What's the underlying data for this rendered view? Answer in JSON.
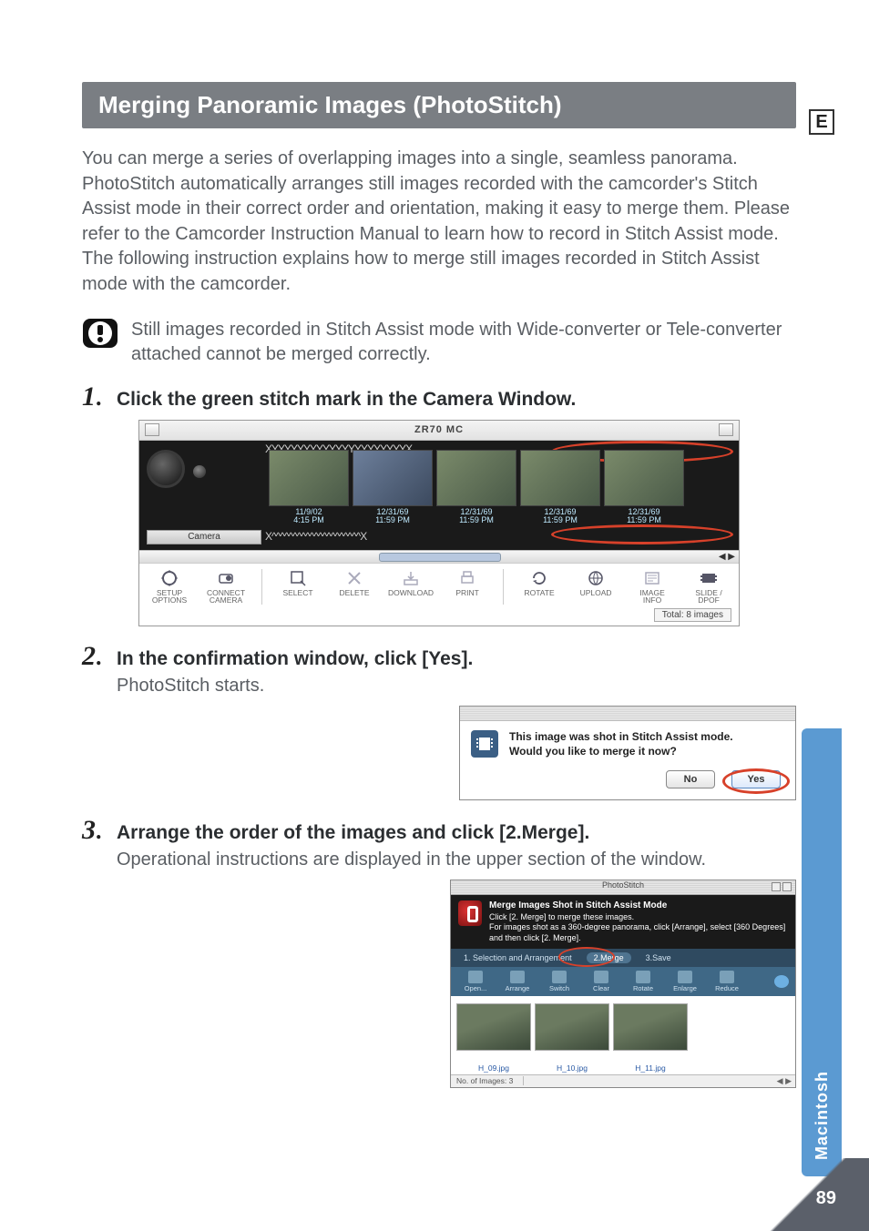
{
  "sideLetter": "E",
  "sideTab": "Macintosh",
  "pageNumber": "89",
  "titleBar": "Merging Panoramic Images (PhotoStitch)",
  "intro": "You can merge a series of overlapping images into a single, seamless panorama. PhotoStitch automatically arranges still images recorded with the camcorder's Stitch Assist mode in their correct order and orientation, making it easy to merge them. Please refer to the Camcorder Instruction Manual to learn how to record in Stitch Assist mode.\nThe following instruction explains how to merge still images recorded in Stitch Assist mode with the camcorder.",
  "caution": "Still images recorded in Stitch Assist mode with Wide-converter or Tele-converter attached cannot be merged correctly.",
  "steps": {
    "s1": {
      "num": "1",
      "head": "Click the green stitch mark in the Camera Window."
    },
    "s2": {
      "num": "2",
      "head": "In the confirmation window, click [Yes].",
      "desc": "PhotoStitch starts."
    },
    "s3": {
      "num": "3",
      "head": "Arrange the order of the images and click [2.Merge].",
      "desc": "Operational instructions are displayed in the upper section of the window."
    }
  },
  "cameraWindow": {
    "title": "ZR70 MC",
    "cameraLabel": "Camera",
    "thumbs": [
      {
        "date": "11/9/02",
        "time": "4:15 PM"
      },
      {
        "date": "12/31/69",
        "time": "11:59 PM"
      },
      {
        "date": "12/31/69",
        "time": "11:59 PM"
      },
      {
        "date": "12/31/69",
        "time": "11:59 PM"
      },
      {
        "date": "12/31/69",
        "time": "11:59 PM"
      }
    ],
    "xRow": "XYYYYYYYYYYYYYYYYYYYYYX",
    "xRowBot": "X^^^^^^^^^^^^^^^^^^^^^X",
    "toolbar": [
      {
        "cap": "SETUP OPTIONS"
      },
      {
        "cap": "CONNECT CAMERA"
      },
      {
        "cap": "SELECT"
      },
      {
        "cap": "DELETE"
      },
      {
        "cap": "DOWNLOAD"
      },
      {
        "cap": "PRINT"
      },
      {
        "cap": "ROTATE"
      },
      {
        "cap": "UPLOAD"
      },
      {
        "cap": "IMAGE INFO"
      },
      {
        "cap": "SLIDE / DPOF"
      }
    ],
    "total": "Total: 8 images"
  },
  "confirm": {
    "line1": "This image was shot in Stitch Assist mode.",
    "line2": "Would you like to merge it now?",
    "no": "No",
    "yes": "Yes"
  },
  "photostitch": {
    "title": "PhotoStitch",
    "descHead": "Merge Images Shot in Stitch Assist Mode",
    "descBody": "Click [2. Merge] to merge these images.\nFor images shot as a 360-degree panorama, click [Arrange], select [360 Degrees] and then click [2. Merge].",
    "tabs": [
      "1. Selection and Arrangement",
      "2.Merge",
      "3.Save"
    ],
    "tools": [
      "Open...",
      "Arrange",
      "Switch",
      "Clear",
      "Rotate",
      "Enlarge",
      "Reduce"
    ],
    "thumbs": [
      "H_09.jpg",
      "H_10.jpg",
      "H_11.jpg"
    ],
    "status": "No. of Images: 3"
  }
}
